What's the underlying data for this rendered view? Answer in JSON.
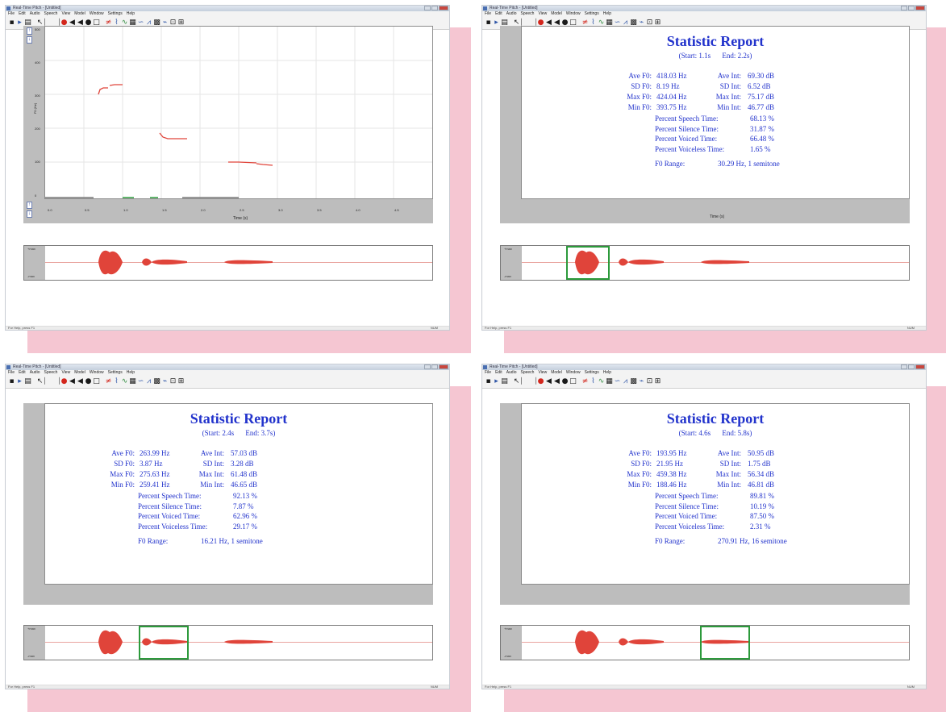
{
  "windows": [
    {
      "title": "Real-Time Pitch - [Untitled]",
      "menu": [
        "File",
        "Edit",
        "Audio",
        "Speech",
        "View",
        "Model",
        "Window",
        "Settings",
        "Help"
      ],
      "status_left": "For Help, press F1",
      "status_right": "NUM",
      "plot": {
        "y_axis_label": "F0 (Hz)",
        "x_axis_label": "Time (s)",
        "y_ticks": [
          "500",
          "400",
          "300",
          "200",
          "100",
          "0"
        ],
        "x_ticks": [
          "0.0",
          "0.5",
          "1.0",
          "1.5",
          "2.0",
          "2.5",
          "3.0",
          "3.5",
          "4.0",
          "4.5",
          "5.0",
          "5.5"
        ]
      },
      "wave_ticks": [
        "+max",
        "-max"
      ]
    },
    {
      "title": "Real-Time Pitch - [Untitled]",
      "menu": [
        "File",
        "Edit",
        "Audio",
        "Speech",
        "View",
        "Model",
        "Window",
        "Settings",
        "Help"
      ],
      "status_left": "For Help, press F1",
      "status_right": "NUM",
      "report": {
        "title": "Statistic Report",
        "start": "(Start: 1.1s",
        "end": "End: 2.2s)",
        "ave_f0_label": "Ave F0:",
        "ave_f0": "418.03 Hz",
        "ave_int_label": "Ave Int:",
        "ave_int": "69.30 dB",
        "sd_f0_label": "SD F0:",
        "sd_f0": "8.19 Hz",
        "sd_int_label": "SD Int:",
        "sd_int": "6.52 dB",
        "max_f0_label": "Max F0:",
        "max_f0": "424.04 Hz",
        "max_int_label": "Max Int:",
        "max_int": "75.17 dB",
        "min_f0_label": "Min F0:",
        "min_f0": "393.75 Hz",
        "min_int_label": "Min Int:",
        "min_int": "46.77 dB",
        "speech_label": "Percent Speech Time:",
        "speech": "68.13 %",
        "silence_label": "Percent Silence Time:",
        "silence": "31.87 %",
        "voiced_label": "Percent Voiced Time:",
        "voiced": "66.48 %",
        "voiceless_label": "Percent Voiceless Time:",
        "voiceless": "1.65 %",
        "range_label": "F0 Range:",
        "range": "30.29 Hz,  1 semitone"
      },
      "x_axis_label": "Time (s)",
      "wave_ticks": [
        "+max",
        "-max"
      ]
    },
    {
      "title": "Real-Time Pitch - [Untitled]",
      "menu": [
        "File",
        "Edit",
        "Audio",
        "Speech",
        "View",
        "Model",
        "Window",
        "Settings",
        "Help"
      ],
      "status_left": "For Help, press F1",
      "status_right": "NUM",
      "report": {
        "title": "Statistic Report",
        "start": "(Start: 2.4s",
        "end": "End: 3.7s)",
        "ave_f0_label": "Ave F0:",
        "ave_f0": "263.99 Hz",
        "ave_int_label": "Ave Int:",
        "ave_int": "57.03 dB",
        "sd_f0_label": "SD F0:",
        "sd_f0": "3.87 Hz",
        "sd_int_label": "SD Int:",
        "sd_int": "3.28 dB",
        "max_f0_label": "Max F0:",
        "max_f0": "275.63 Hz",
        "max_int_label": "Max Int:",
        "max_int": "61.48 dB",
        "min_f0_label": "Min F0:",
        "min_f0": "259.41 Hz",
        "min_int_label": "Min Int:",
        "min_int": "46.65 dB",
        "speech_label": "Percent Speech Time:",
        "speech": "92.13 %",
        "silence_label": "Percent Silence Time:",
        "silence": "7.87 %",
        "voiced_label": "Percent Voiced Time:",
        "voiced": "62.96 %",
        "voiceless_label": "Percent Voiceless Time:",
        "voiceless": "29.17 %",
        "range_label": "F0 Range:",
        "range": "16.21 Hz,  1 semitone"
      },
      "wave_ticks": [
        "+max",
        "-max"
      ]
    },
    {
      "title": "Real-Time Pitch - [Untitled]",
      "menu": [
        "File",
        "Edit",
        "Audio",
        "Speech",
        "View",
        "Model",
        "Window",
        "Settings",
        "Help"
      ],
      "status_left": "For Help, press F1",
      "status_right": "NUM",
      "report": {
        "title": "Statistic Report",
        "start": "(Start: 4.6s",
        "end": "End: 5.8s)",
        "ave_f0_label": "Ave F0:",
        "ave_f0": "193.95 Hz",
        "ave_int_label": "Ave Int:",
        "ave_int": "50.95 dB",
        "sd_f0_label": "SD F0:",
        "sd_f0": "21.95 Hz",
        "sd_int_label": "SD Int:",
        "sd_int": "1.75 dB",
        "max_f0_label": "Max F0:",
        "max_f0": "459.38 Hz",
        "max_int_label": "Max Int:",
        "max_int": "56.34 dB",
        "min_f0_label": "Min F0:",
        "min_f0": "188.46 Hz",
        "min_int_label": "Min Int:",
        "min_int": "46.81 dB",
        "speech_label": "Percent Speech Time:",
        "speech": "89.81 %",
        "silence_label": "Percent Silence Time:",
        "silence": "10.19 %",
        "voiced_label": "Percent Voiced Time:",
        "voiced": "87.50 %",
        "voiceless_label": "Percent Voiceless Time:",
        "voiceless": "2.31 %",
        "range_label": "F0 Range:",
        "range": "270.91 Hz,  16 semitone"
      },
      "wave_ticks": [
        "+max",
        "-max"
      ]
    }
  ],
  "colors": {
    "report_text": "#2233cc",
    "pitch_trace": "#e0443a",
    "selection": "#2c9a3b",
    "shadow": "#f5c6d2",
    "gray_panel": "#bdbdbd"
  },
  "icons": [
    "new-file-icon",
    "open-icon",
    "print-icon",
    "cursor-icon",
    "record-icon",
    "play-icon",
    "stop-icon",
    "select-icon",
    "zoom-icon",
    "stats-icon"
  ]
}
